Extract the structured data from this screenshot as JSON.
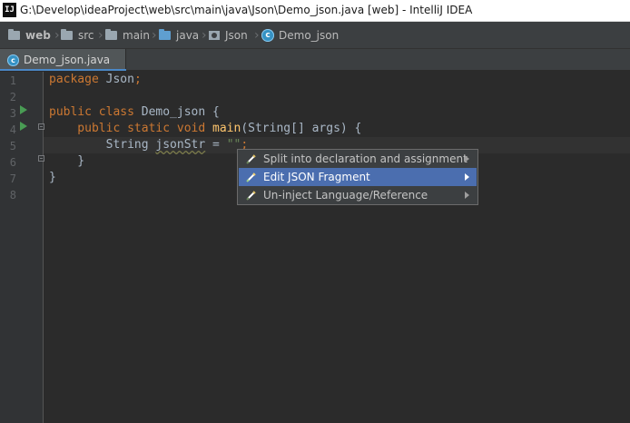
{
  "window": {
    "app_icon": "IJ",
    "title": "G:\\Develop\\ideaProject\\web\\src\\main\\java\\Json\\Demo_json.java [web] - IntelliJ IDEA"
  },
  "breadcrumbs": [
    {
      "label": "web",
      "icon": "folder-icon"
    },
    {
      "label": "src",
      "icon": "folder-icon"
    },
    {
      "label": "main",
      "icon": "folder-icon"
    },
    {
      "label": "java",
      "icon": "folder-icon"
    },
    {
      "label": "Json",
      "icon": "package-icon"
    },
    {
      "label": "Demo_json",
      "icon": "class-icon"
    }
  ],
  "tabs": [
    {
      "label": "Demo_json.java",
      "icon": "class-icon",
      "active": true
    }
  ],
  "editor": {
    "line_numbers": [
      "1",
      "2",
      "3",
      "4",
      "5",
      "6",
      "7",
      "8"
    ],
    "lines": [
      [
        "package",
        " Json",
        ";"
      ],
      [],
      [
        "public class ",
        "Demo_json",
        " {"
      ],
      [
        "    public static void ",
        "main",
        "(String[] args) {"
      ],
      [
        "        String ",
        "jsonStr",
        " = ",
        "\"\"",
        ";"
      ],
      [
        "    }"
      ],
      [
        "}"
      ],
      []
    ],
    "class_icon_letter": "c"
  },
  "context_menu": {
    "items": [
      {
        "label": "Split into declaration and assignment",
        "icon": "intention-bulb-icon",
        "selected": false
      },
      {
        "label": "Edit JSON Fragment",
        "icon": "intention-bulb-icon",
        "selected": true
      },
      {
        "label": "Un-inject Language/Reference",
        "icon": "intention-bulb-icon",
        "selected": false
      }
    ]
  },
  "colors": {
    "editor_bg": "#2b2b2b",
    "keyword": "#cc7832",
    "method": "#ffc66d",
    "string": "#6a8759",
    "selection": "#4b6eaf",
    "run_gutter": "#499c54"
  }
}
